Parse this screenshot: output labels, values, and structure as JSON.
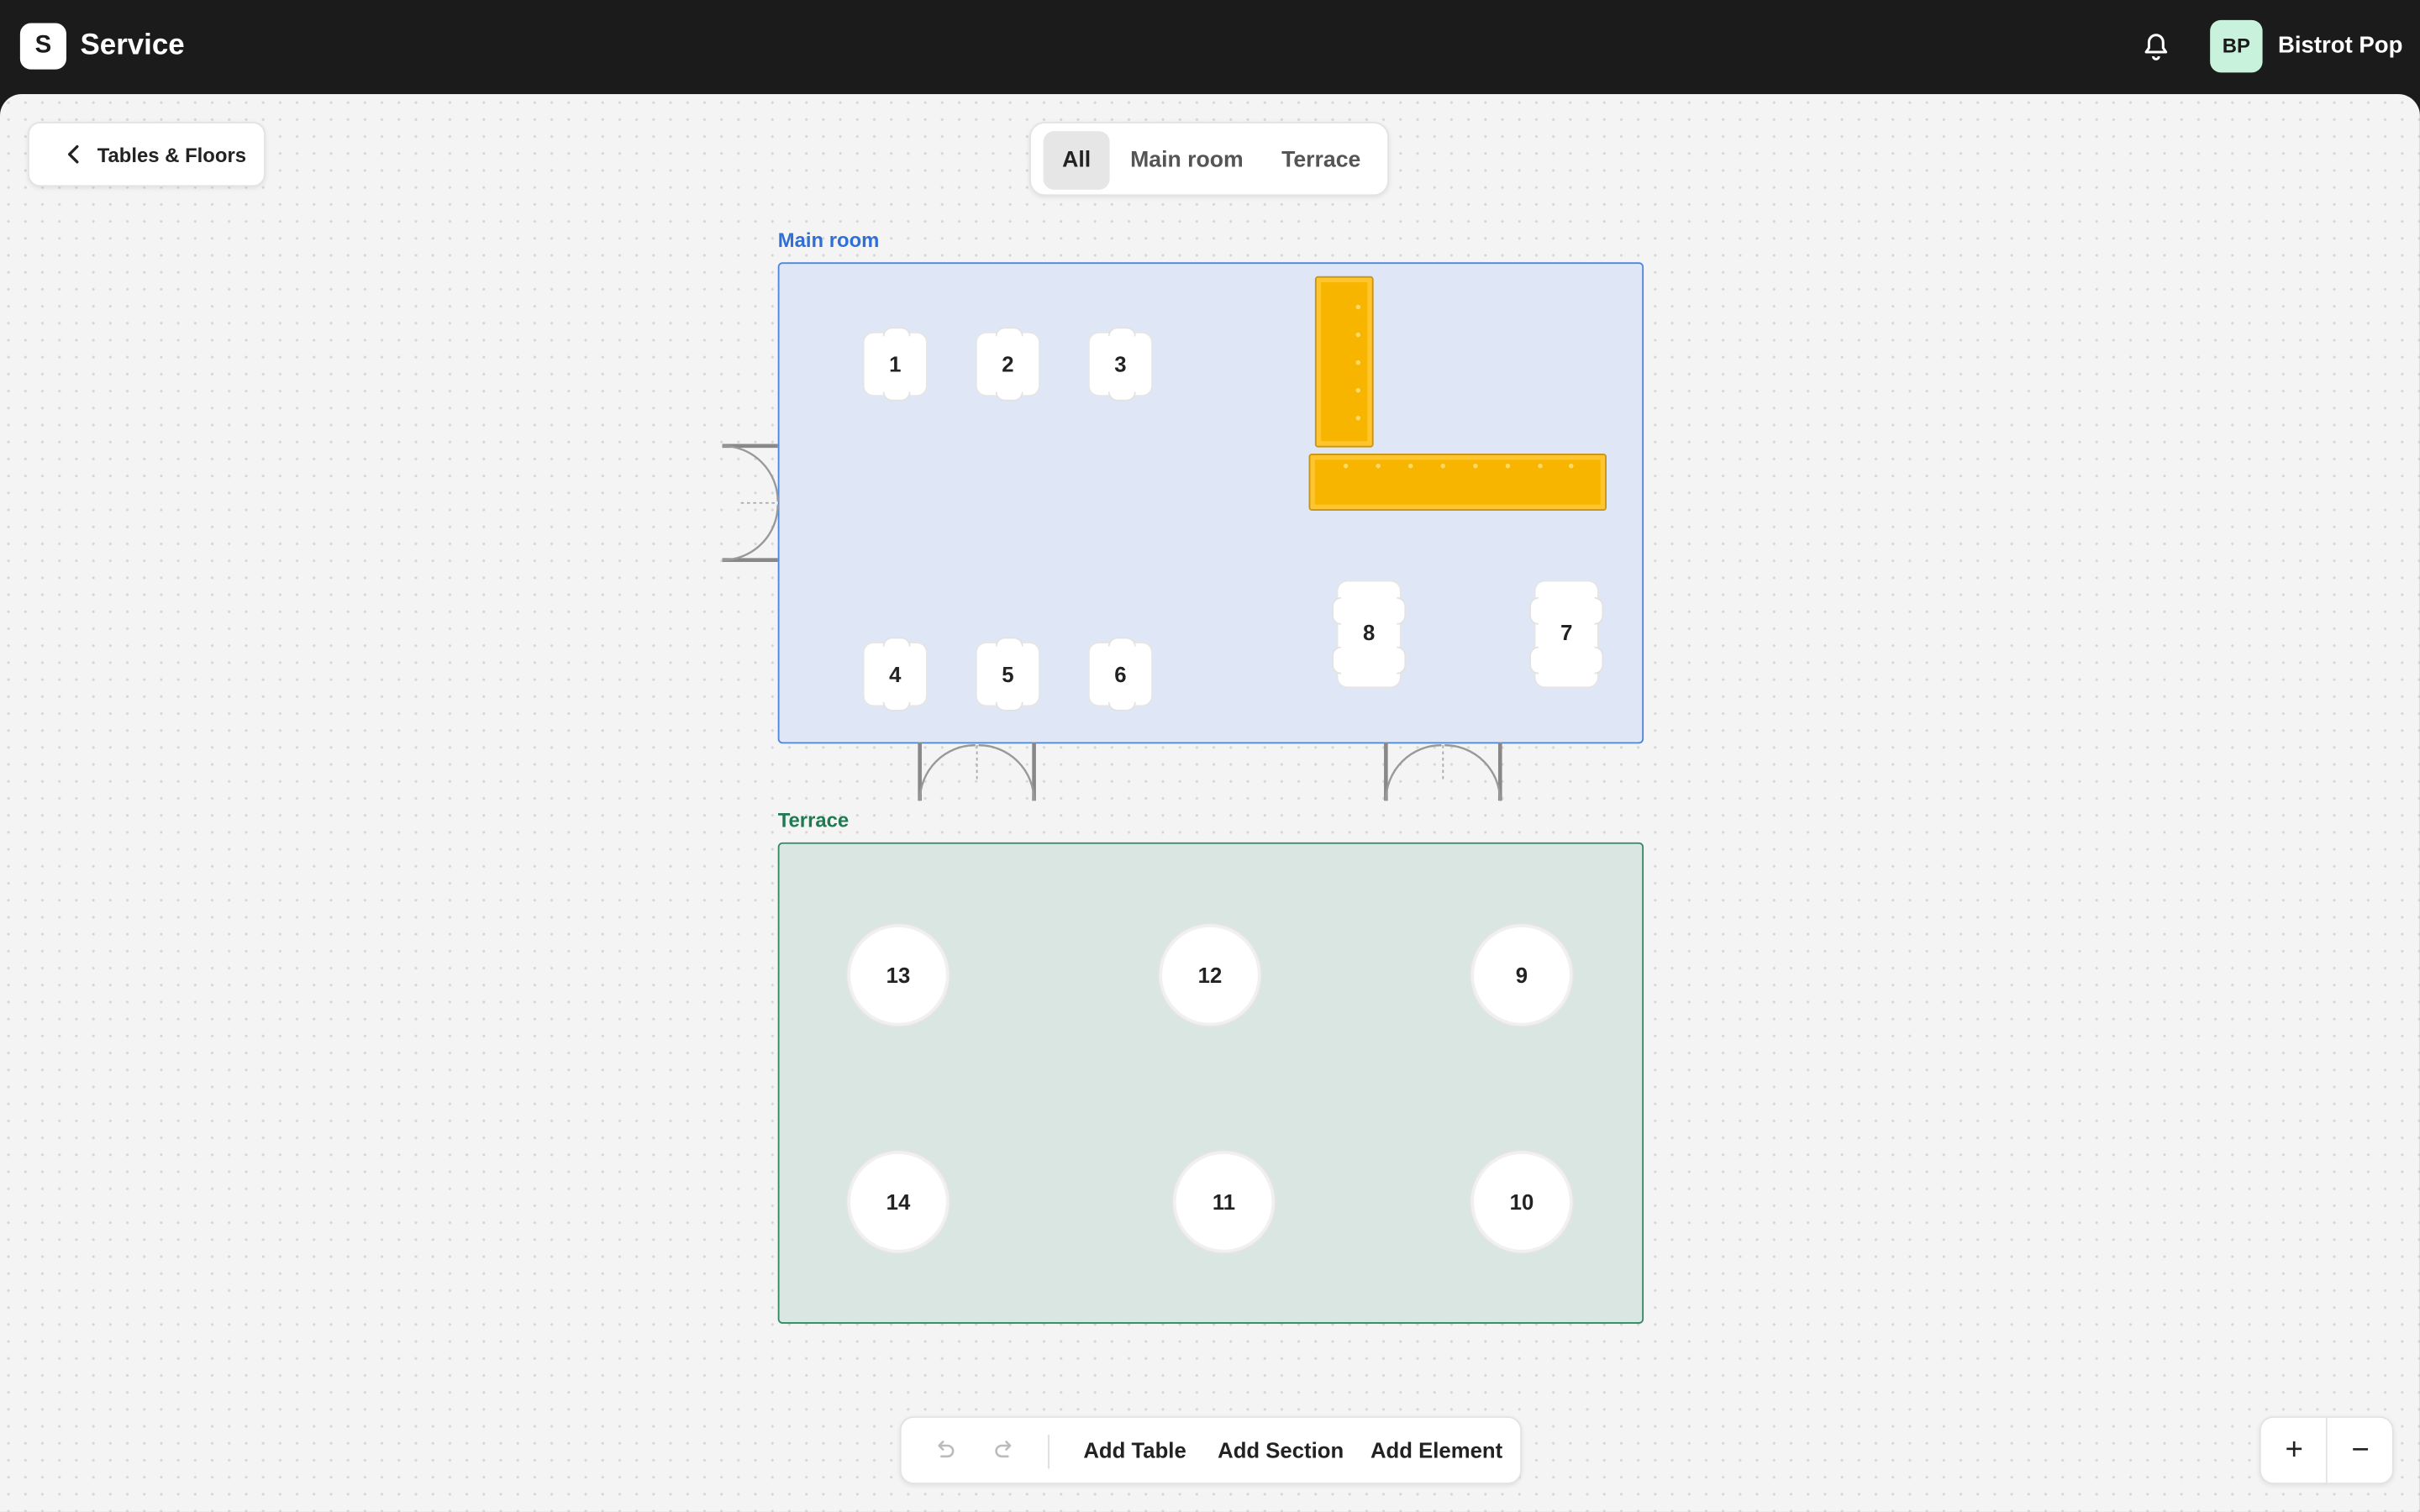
{
  "app": {
    "logo_letter": "S",
    "title": "Service"
  },
  "account": {
    "initials": "BP",
    "name": "Bistrot Pop"
  },
  "back_button": {
    "label": "Tables & Floors"
  },
  "filter_tabs": [
    {
      "label": "All",
      "active": true
    },
    {
      "label": "Main room",
      "active": false
    },
    {
      "label": "Terrace",
      "active": false
    }
  ],
  "sections": {
    "main": {
      "label": "Main room",
      "color": "#4a86e0",
      "fill": "#dfe7f6",
      "tables": [
        "1",
        "2",
        "3",
        "4",
        "5",
        "6",
        "8",
        "7"
      ]
    },
    "terrace": {
      "label": "Terrace",
      "color": "#2f8a64",
      "fill": "#d9e6e2",
      "tables": [
        "13",
        "12",
        "9",
        "14",
        "11",
        "10"
      ]
    }
  },
  "toolbar": {
    "undo_icon": "undo-icon",
    "redo_icon": "redo-icon",
    "add_table": "Add Table",
    "add_section": "Add Section",
    "add_element": "Add Element"
  },
  "zoom": {
    "in": "+",
    "out": "−"
  },
  "colors": {
    "bar": "#f7b500",
    "topbar": "#1b1b1b",
    "avatar_bg": "#c9f2dc"
  }
}
